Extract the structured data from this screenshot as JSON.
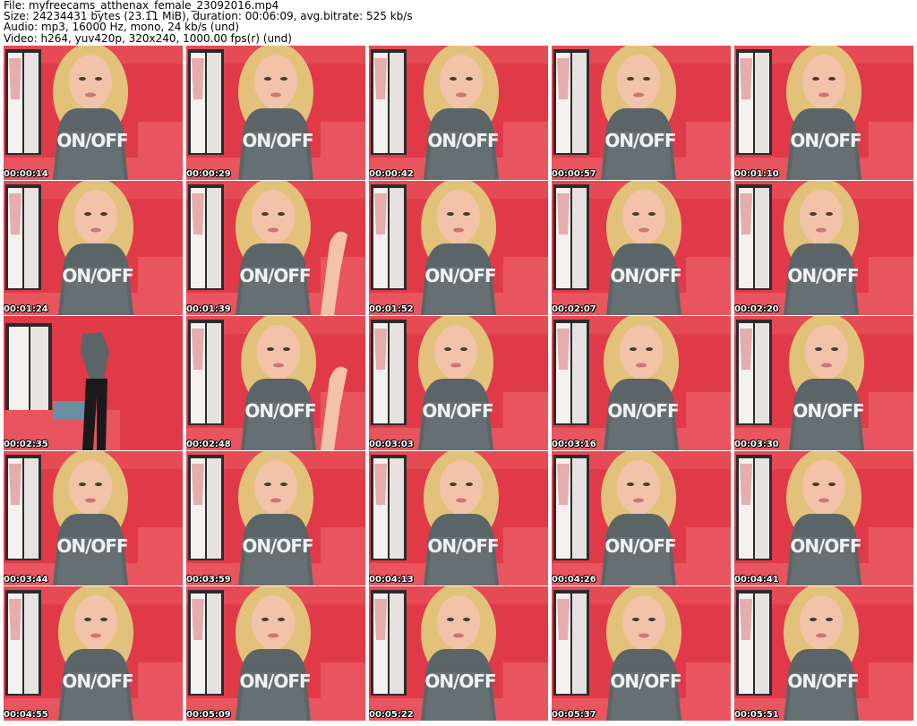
{
  "header": {
    "file": "File: myfreecams_atthenax_female_23092016.mp4",
    "size": "Size: 24234431 bytes (23.11 MiB), duration: 00:06:09, avg.bitrate: 525 kb/s",
    "audio": "Audio: mp3, 16000 Hz, mono, 24 kb/s (und)",
    "video": "Video: h264, yuv420p, 320x240, 1000.00 fps(r) (und)"
  },
  "shirt_text": "ON/OFF",
  "colors": {
    "background_wall": "#e03a48",
    "bed": "#e8555f",
    "shirt": "#5b6466",
    "hair": "#e2c27a",
    "skin": "#f2c3a8"
  },
  "thumbnails": [
    {
      "time": "00:00:14"
    },
    {
      "time": "00:00:29"
    },
    {
      "time": "00:00:42"
    },
    {
      "time": "00:00:57"
    },
    {
      "time": "00:01:10"
    },
    {
      "time": "00:01:24"
    },
    {
      "time": "00:01:39"
    },
    {
      "time": "00:01:52"
    },
    {
      "time": "00:02:07"
    },
    {
      "time": "00:02:20"
    },
    {
      "time": "00:02:35"
    },
    {
      "time": "00:02:48"
    },
    {
      "time": "00:03:03"
    },
    {
      "time": "00:03:16"
    },
    {
      "time": "00:03:30"
    },
    {
      "time": "00:03:44"
    },
    {
      "time": "00:03:59"
    },
    {
      "time": "00:04:13"
    },
    {
      "time": "00:04:26"
    },
    {
      "time": "00:04:41"
    },
    {
      "time": "00:04:55"
    },
    {
      "time": "00:05:09"
    },
    {
      "time": "00:05:22"
    },
    {
      "time": "00:05:37"
    },
    {
      "time": "00:05:51"
    }
  ]
}
